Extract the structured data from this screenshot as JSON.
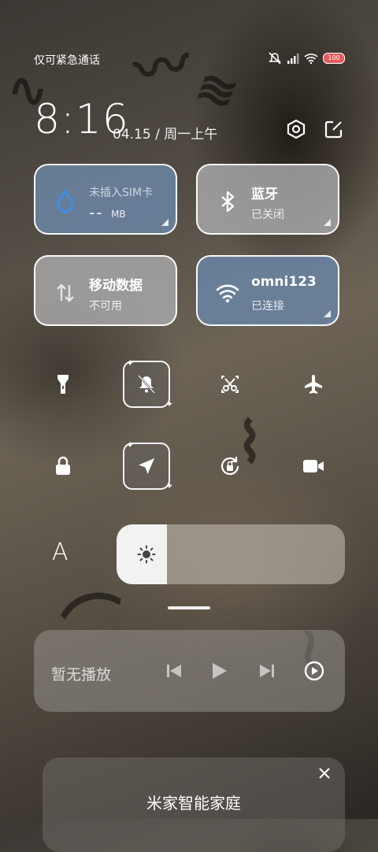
{
  "status_bar": {
    "carrier": "仅可紧急通话",
    "battery": "100"
  },
  "header": {
    "time": "8:16",
    "date": "04.15 / 周一上午"
  },
  "tiles": {
    "sim": {
      "title": "未插入SIM卡",
      "value": "--",
      "unit": "MB"
    },
    "bluetooth": {
      "title": "蓝牙",
      "status": "已关闭"
    },
    "mobile_data": {
      "title": "移动数据",
      "status": "不可用"
    },
    "wifi": {
      "title": "omni123",
      "status": "已连接"
    }
  },
  "brightness": {
    "level_percent": 22
  },
  "media": {
    "label": "暂无播放"
  },
  "card": {
    "title": "米家智能家庭"
  },
  "colors": {
    "tile_blue": "#69829e",
    "tile_gray": "#aaaaaa",
    "drop_blue": "#3d8ee6",
    "battery_red": "#e85b5b"
  }
}
